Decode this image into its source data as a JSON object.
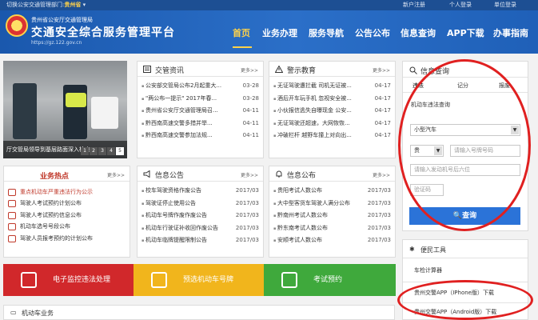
{
  "topbar": {
    "switch_label": "切换公安交通管理部门:",
    "region": "贵州省",
    "links": [
      "新户注册",
      "个人登录",
      "单位登录"
    ]
  },
  "header": {
    "logo_small": "贵州省公安厅交通管理局",
    "logo_title": "交通安全综合服务管理平台",
    "logo_url": "https://gz.122.gov.cn"
  },
  "nav": [
    "首页",
    "业务办理",
    "服务导航",
    "公告公布",
    "信息查询",
    "APP下载",
    "办事指南"
  ],
  "slider": {
    "caption": "厅交管局领导到基层路面深入检查...",
    "pages": [
      "1",
      "2",
      "3",
      "4",
      "5"
    ]
  },
  "traffic_news": {
    "title": "交管资讯",
    "more": "更多>>",
    "items": [
      {
        "text": "公安部交管局公布2月起重大...",
        "date": "03-28"
      },
      {
        "text": "\"两公布一提示\" 2017年春...",
        "date": "03-28"
      },
      {
        "text": "贵州省公安厅交通管理局召...",
        "date": "04-11"
      },
      {
        "text": "黔西南高速交警多措并举...",
        "date": "04-11"
      },
      {
        "text": "黔西南高速交警参加法规...",
        "date": "04-11"
      }
    ]
  },
  "warning_edu": {
    "title": "警示教育",
    "more": "更多>>",
    "items": [
      {
        "text": "无证驾驶遭拦截 司机无证被...",
        "date": "04-17"
      },
      {
        "text": "酒后开车玩手机 忽视安全被...",
        "date": "04-17"
      },
      {
        "text": "小伙报信逃失自曝现金 公安...",
        "date": "04-17"
      },
      {
        "text": "无证驾驶还超速，大网恢恢...",
        "date": "04-17"
      },
      {
        "text": "冲破栏杆 越野车撞上对向出...",
        "date": "04-17"
      }
    ]
  },
  "hot_topics": {
    "title": "业务热点",
    "more": "更多>>",
    "items": [
      "重点机动车严重违法行为公示",
      "驾驶人考试预约计划公布",
      "驾驶人考试预约信息公布",
      "机动车选号号段公布",
      "驾驶人员报考预约的计划公布"
    ]
  },
  "info_notice": {
    "title": "信息公告",
    "more": "更多>>",
    "items": [
      {
        "text": "校车驾驶资格作废公告",
        "date": "2017/03"
      },
      {
        "text": "驾驶证停止使用公告",
        "date": "2017/03"
      },
      {
        "text": "机动车号牌作废作废公告",
        "date": "2017/03"
      },
      {
        "text": "机动车行驶证补收回作废公告",
        "date": "2017/03"
      },
      {
        "text": "机动车临牌提醒限制公告",
        "date": "2017/03"
      }
    ]
  },
  "info_publish": {
    "title": "信息公布",
    "more": "更多>>",
    "items": [
      {
        "text": "贵阳考试人数公布",
        "date": "2017/03"
      },
      {
        "text": "大中型客货车驾驶人满分公布",
        "date": "2017/03"
      },
      {
        "text": "黔南州考试人数公布",
        "date": "2017/03"
      },
      {
        "text": "黔东南考试人数公布",
        "date": "2017/03"
      },
      {
        "text": "安顺考试人数公布",
        "date": "2017/03"
      }
    ]
  },
  "banners": [
    {
      "label": "电子监控违法处理",
      "color": "#d1282b"
    },
    {
      "label": "预选机动车号牌",
      "color": "#f1b51c"
    },
    {
      "label": "考试预约",
      "color": "#3fa93c"
    }
  ],
  "query": {
    "title": "信息查询",
    "tabs": [
      "违法",
      "记分",
      "报废"
    ],
    "subtitle": "机动车违法查询",
    "vehicle_type": "小型汽车",
    "province": "贵",
    "plate_placeholder": "请输入号牌号码",
    "engine_placeholder": "请输入发动机号后六位",
    "captcha_placeholder": "验证码",
    "submit": "查询"
  },
  "tools": {
    "title": "便民工具",
    "items": [
      "车检计算器",
      "贵州交警APP（IPhone版）下载",
      "贵州交警APP（Android版）下载"
    ]
  },
  "bottom": {
    "title": "机动车业务"
  }
}
